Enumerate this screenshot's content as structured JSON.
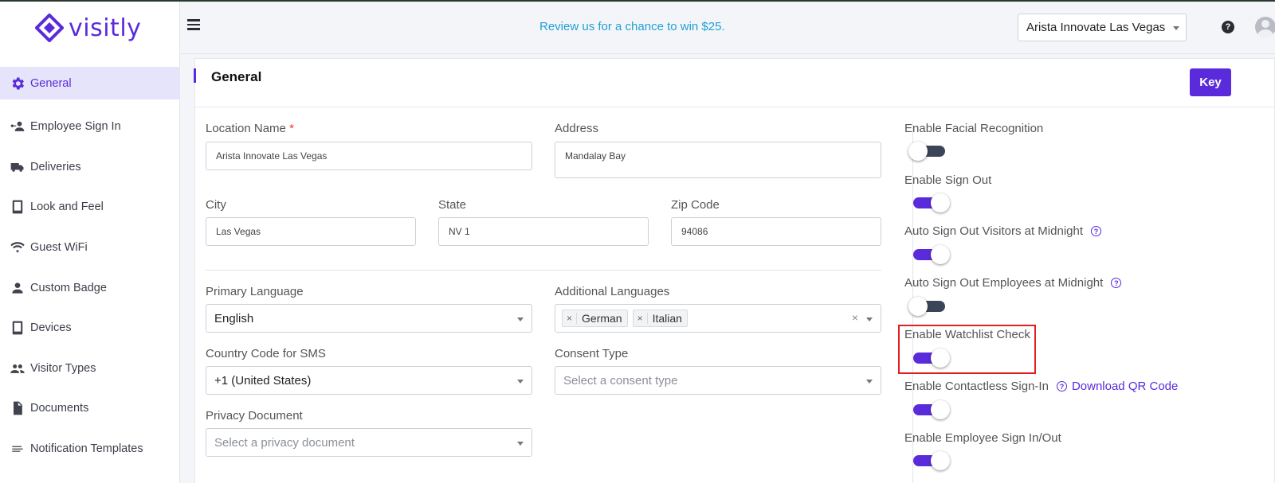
{
  "brand": {
    "name": "visitly",
    "logo_color": "#5a2bdb"
  },
  "accent_color": "#5a2bdb",
  "sidebar": {
    "items": [
      {
        "label": "General",
        "icon": "gear-icon",
        "active": true
      },
      {
        "label": "Employee Sign In",
        "icon": "employee-sign-in-icon"
      },
      {
        "label": "Deliveries",
        "icon": "truck-icon"
      },
      {
        "label": "Look and Feel",
        "icon": "tablet-icon"
      },
      {
        "label": "Guest WiFi",
        "icon": "wifi-icon"
      },
      {
        "label": "Custom Badge",
        "icon": "person-icon"
      },
      {
        "label": "Devices",
        "icon": "tablet-icon"
      },
      {
        "label": "Visitor Types",
        "icon": "people-icon"
      },
      {
        "label": "Documents",
        "icon": "document-icon"
      },
      {
        "label": "Notification Templates",
        "icon": "notes-icon"
      }
    ]
  },
  "header": {
    "promo": "Review us for a chance to win $25.",
    "location": "Arista Innovate Las Vegas"
  },
  "card": {
    "title": "General",
    "key_button": "Key"
  },
  "form": {
    "location_name_label": "Location Name",
    "required_mark": "*",
    "location_name_value": "Arista Innovate Las Vegas",
    "address_label": "Address",
    "address_value": "Mandalay Bay",
    "city_label": "City",
    "city_value": "Las Vegas",
    "state_label": "State",
    "state_value": "NV 1",
    "zip_label": "Zip Code",
    "zip_value": "94086",
    "primary_language_label": "Primary Language",
    "primary_language_value": "English",
    "additional_languages_label": "Additional Languages",
    "additional_languages": [
      "German",
      "Italian"
    ],
    "country_code_label": "Country Code for SMS",
    "country_code_value": "+1 (United States)",
    "consent_type_label": "Consent Type",
    "consent_type_placeholder": "Select a consent type",
    "privacy_document_label": "Privacy Document",
    "privacy_document_placeholder": "Select a privacy document"
  },
  "toggles": [
    {
      "label": "Enable Facial Recognition",
      "on": false
    },
    {
      "label": "Enable Sign Out",
      "on": true
    },
    {
      "label": "Auto Sign Out Visitors at Midnight",
      "on": true,
      "help": true
    },
    {
      "label": "Auto Sign Out Employees at Midnight",
      "on": false,
      "help": true
    },
    {
      "label": "Enable Watchlist Check",
      "on": true,
      "highlighted": true
    },
    {
      "label": "Enable Contactless Sign-In",
      "on": true,
      "help": true,
      "link": "Download QR Code"
    },
    {
      "label": "Enable Employee Sign In/Out",
      "on": true
    }
  ]
}
